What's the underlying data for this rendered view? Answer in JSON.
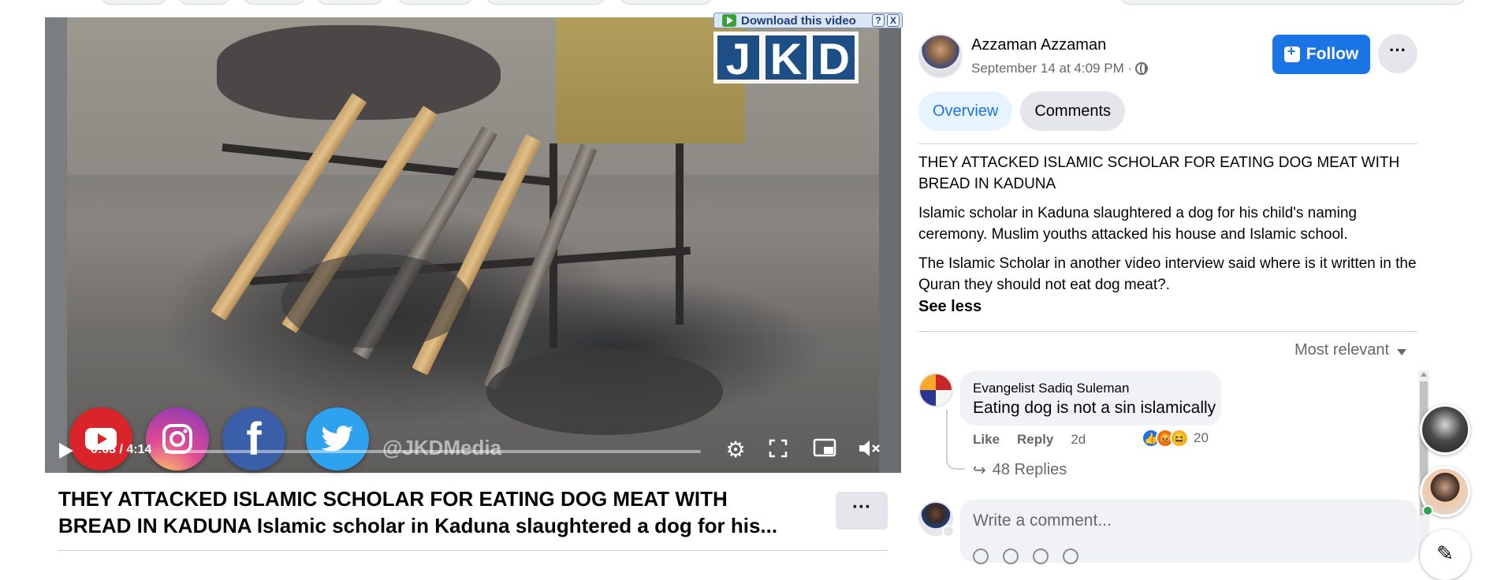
{
  "video": {
    "download_label": "Download this video",
    "help_glyph": "?",
    "close_glyph": "X",
    "watermark_letters": [
      "J",
      "K",
      "D"
    ],
    "handle": "@JKDMedia",
    "time": "0:03 / 4:14",
    "progress": 0.012,
    "social_icons": [
      "youtube-icon",
      "instagram-icon",
      "facebook-icon",
      "twitter-icon"
    ]
  },
  "post": {
    "title_line1": "THEY ATTACKED ISLAMIC SCHOLAR FOR EATING DOG MEAT WITH",
    "title_line2_bold": "BREAD IN KADUNA",
    "title_line2_rest": " Islamic scholar in Kaduna slaughtered a dog for his...",
    "more_glyph": "···"
  },
  "author": {
    "name": "Azzaman Azzaman",
    "date": "September 14 at 4:09 PM ·",
    "follow_label": "Follow",
    "more_glyph": "···"
  },
  "tabs": [
    {
      "label": "Overview",
      "active": true
    },
    {
      "label": "Comments",
      "active": false
    }
  ],
  "description": {
    "p1": "THEY ATTACKED ISLAMIC SCHOLAR FOR EATING DOG MEAT WITH BREAD IN KADUNA",
    "p2": "Islamic scholar in Kaduna slaughtered a dog for his child's naming ceremony. Muslim youths attacked his house and Islamic school.",
    "p3": "The Islamic Scholar in another video interview said where is it written in the Quran they should not eat dog meat?.",
    "see_less": "See less"
  },
  "comments": {
    "sort_label": "Most relevant",
    "items": [
      {
        "author": "Evangelist Sadiq Suleman",
        "text": "Eating dog is not a sin islamically",
        "like": "Like",
        "reply": "Reply",
        "age": "2d",
        "reaction_count": "20",
        "replies_label": "48 Replies"
      }
    ],
    "write_placeholder": "Write a comment..."
  },
  "colors": {
    "accent": "#1b74e4",
    "muted_text": "#65676b",
    "bubble_bg": "#f0f2f5"
  }
}
